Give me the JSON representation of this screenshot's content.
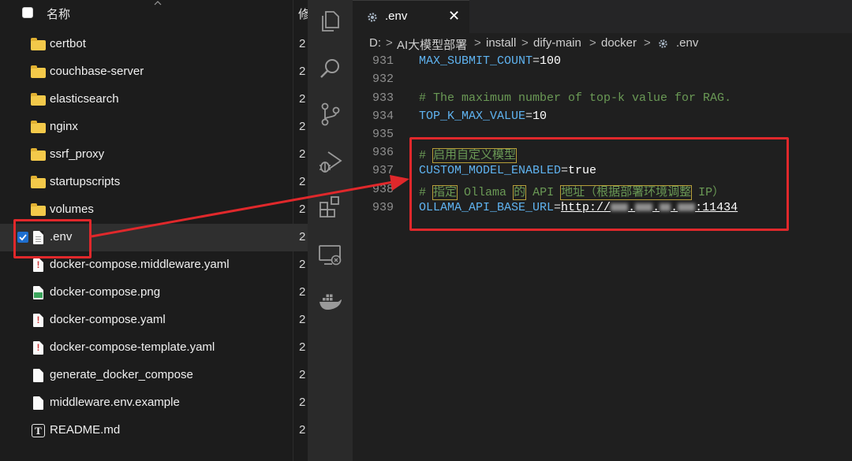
{
  "explorer": {
    "header": {
      "name_col": "名称",
      "modified_col": "修"
    },
    "rows": [
      {
        "name": "certbot",
        "type": "folder",
        "modified": "2"
      },
      {
        "name": "couchbase-server",
        "type": "folder",
        "modified": "2"
      },
      {
        "name": "elasticsearch",
        "type": "folder",
        "modified": "2"
      },
      {
        "name": "nginx",
        "type": "folder",
        "modified": "2"
      },
      {
        "name": "ssrf_proxy",
        "type": "folder",
        "modified": "2"
      },
      {
        "name": "startupscripts",
        "type": "folder",
        "modified": "2"
      },
      {
        "name": "volumes",
        "type": "folder",
        "modified": "2"
      },
      {
        "name": ".env",
        "type": "file",
        "modified": "2",
        "selected": true
      },
      {
        "name": "docker-compose.middleware.yaml",
        "type": "yaml",
        "modified": "2"
      },
      {
        "name": "docker-compose.png",
        "type": "image",
        "modified": "2"
      },
      {
        "name": "docker-compose.yaml",
        "type": "yaml",
        "modified": "2"
      },
      {
        "name": "docker-compose-template.yaml",
        "type": "yaml",
        "modified": "2"
      },
      {
        "name": "generate_docker_compose",
        "type": "file",
        "modified": "2"
      },
      {
        "name": "middleware.env.example",
        "type": "file",
        "modified": "2"
      },
      {
        "name": "README.md",
        "type": "markdown",
        "modified": "2"
      }
    ]
  },
  "activity_bar": {
    "icons": [
      "explorer-icon",
      "search-icon",
      "source-control-icon",
      "run-debug-icon",
      "extensions-icon",
      "remote-explorer-icon",
      "docker-icon"
    ]
  },
  "editor": {
    "tab": {
      "label": ".env",
      "close": "✕"
    },
    "breadcrumb": [
      "D:",
      "AI大模型部署",
      "install",
      "dify-main",
      "docker",
      ".env"
    ],
    "breadcrumb_sep": ">",
    "lines": [
      {
        "num": "931",
        "key": "MAX_SUBMIT_COUNT",
        "eq": "=",
        "val": "100"
      },
      {
        "num": "932"
      },
      {
        "num": "933",
        "comment": "# The maximum number of top-k value for RAG."
      },
      {
        "num": "934",
        "key": "TOP_K_MAX_VALUE",
        "eq": "=",
        "val": "10"
      },
      {
        "num": "935"
      },
      {
        "num": "936",
        "comment_hash": "#",
        "comment_hl": "启用自定义模型"
      },
      {
        "num": "937",
        "key": "CUSTOM_MODEL_ENABLED",
        "eq": "=",
        "val": "true"
      },
      {
        "num": "938",
        "comment_hash": "#",
        "seg1": "指定",
        "seg2": " Ollama ",
        "seg3": "的",
        "seg4": " API ",
        "seg5": "地址（根据部署环境调整",
        "seg6": " IP）"
      },
      {
        "num": "939",
        "key": "OLLAMA_API_BASE_URL",
        "eq": "=",
        "url_prefix": "http://",
        "url_suffix": ":11434"
      }
    ]
  },
  "colors": {
    "annotation_red": "#e0282b",
    "keyword_blue": "#5fb3f0",
    "comment_green": "#6a9955"
  }
}
